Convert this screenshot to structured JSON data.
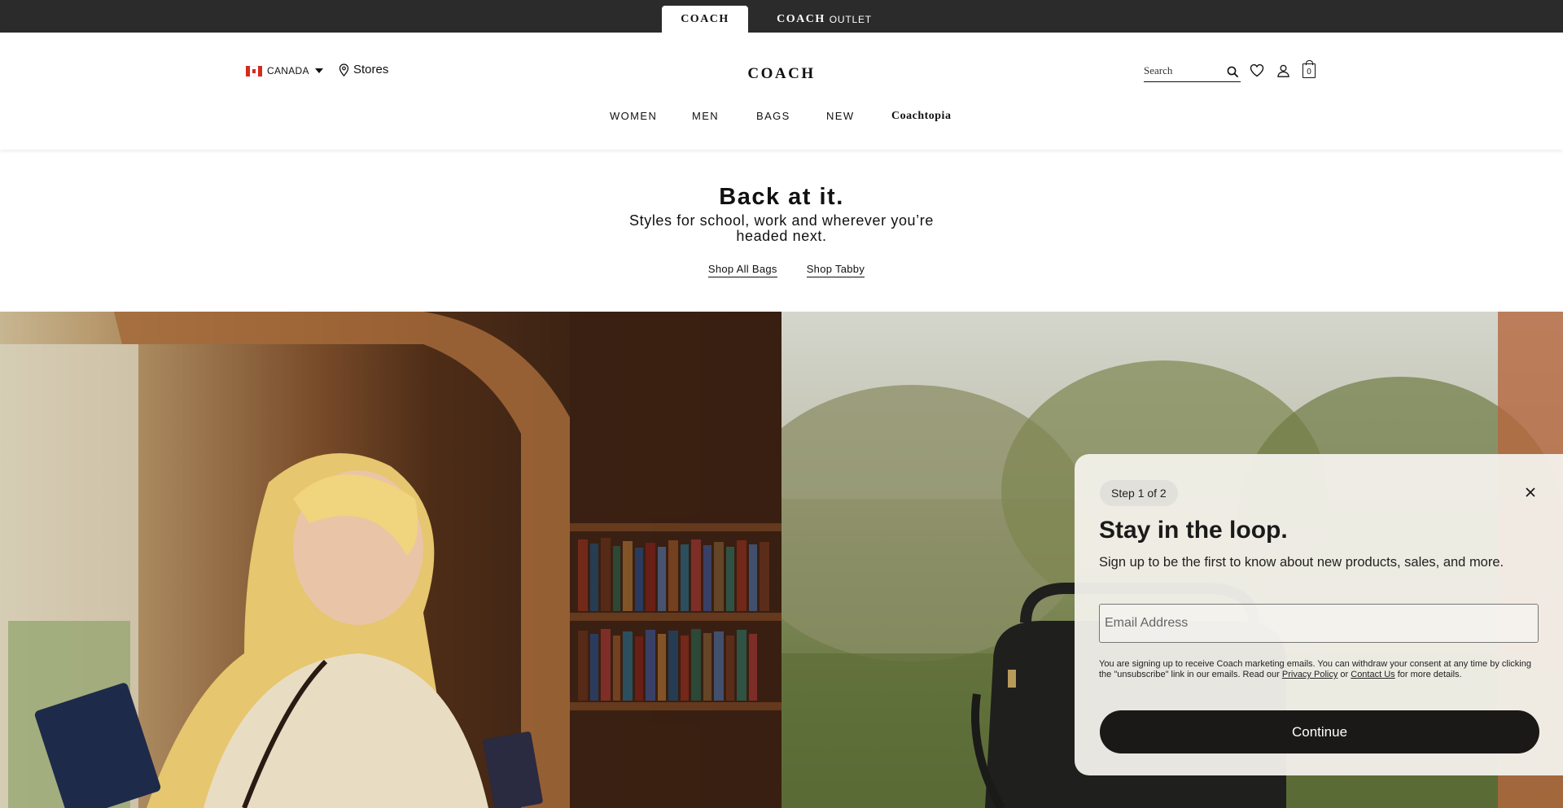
{
  "brandbar": {
    "coach_tab": "COACH",
    "outlet_brand": "COACH",
    "outlet_word": "OUTLET"
  },
  "header": {
    "country": "CANADA",
    "stores_label": "Stores",
    "logo": "COACH",
    "search_placeholder": "Search",
    "bag_count": "0"
  },
  "nav": {
    "items": [
      "WOMEN",
      "MEN",
      "BAGS",
      "NEW",
      "Coachtopia"
    ]
  },
  "hero": {
    "title": "Back at it.",
    "subtitle": "Styles for school, work and wherever you’re headed next.",
    "links": [
      "Shop All Bags",
      "Shop Tabby"
    ]
  },
  "modal": {
    "step": "Step 1 of 2",
    "title": "Stay in the loop.",
    "subtitle": "Sign up to be the first to know about new products, sales, and more.",
    "email_placeholder": "Email Address",
    "legal_prefix": "You are signing up to receive Coach marketing emails. You can withdraw your consent at any time by clicking the \"unsubscribe\" link in our emails. Read our ",
    "privacy_link": "Privacy Policy",
    "legal_or": " or ",
    "contact_link": "Contact Us",
    "legal_suffix": " for more details.",
    "continue_label": "Continue"
  },
  "colors": {
    "brandbar_bg": "#2b2b2b",
    "button_bg": "#1b1917",
    "flag_red": "#d52b1e"
  },
  "icons": [
    "canada-flag-icon",
    "chevron-down-icon",
    "location-pin-icon",
    "search-icon",
    "heart-icon",
    "user-icon",
    "shopping-bag-icon",
    "close-icon"
  ]
}
